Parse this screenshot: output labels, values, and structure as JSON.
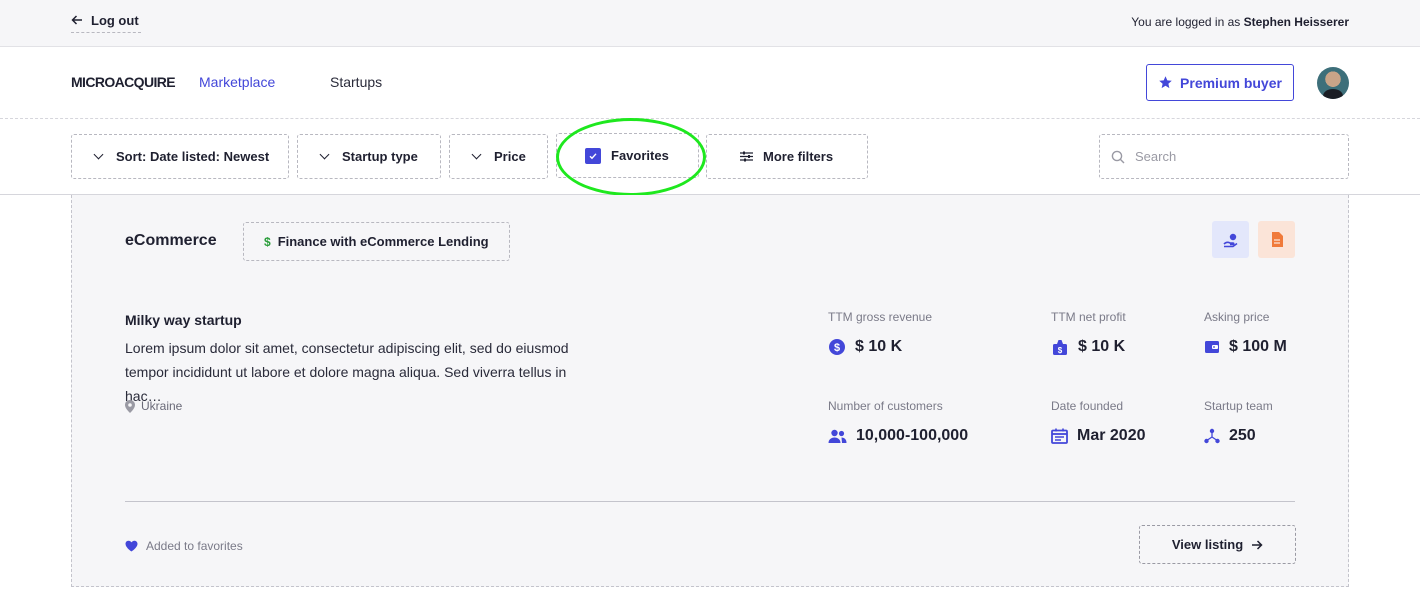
{
  "topbar": {
    "logout_label": "Log out",
    "logged_in_prefix": "You are logged in as",
    "user_name": "Stephen Heisserer"
  },
  "nav": {
    "logo_text": "MICROACQUIRE",
    "links": [
      {
        "label": "Marketplace",
        "active": true
      },
      {
        "label": "Startups",
        "active": false
      }
    ],
    "premium_label": "Premium buyer",
    "accent_color": "#4347d9"
  },
  "filters": {
    "sort_label": "Sort: Date listed: Newest",
    "startup_type_label": "Startup type",
    "price_label": "Price",
    "favorites_label": "Favorites",
    "favorites_checked": true,
    "more_filters_label": "More filters",
    "search_placeholder": "Search",
    "search_value": ""
  },
  "listing": {
    "category": "eCommerce",
    "tag": "Finance with eCommerce Lending",
    "name": "Milky way startup",
    "description": "Lorem ipsum dolor sit amet, consectetur adipiscing elit, sed do eiusmod tempor incididunt ut labore et dolore magna aliqua. Sed viverra tellus in hac…",
    "location": "Ukraine",
    "metrics": {
      "ttm_gross_revenue": {
        "label": "TTM gross revenue",
        "value": "$ 10 K"
      },
      "ttm_net_profit": {
        "label": "TTM net profit",
        "value": "$ 10 K"
      },
      "asking_price": {
        "label": "Asking price",
        "value": "$ 100 M"
      },
      "customers": {
        "label": "Number of customers",
        "value": "10,000-100,000"
      },
      "date_founded": {
        "label": "Date founded",
        "value": "Mar 2020"
      },
      "startup_team": {
        "label": "Startup team",
        "value": "250"
      }
    },
    "favorite_text": "Added to favorites",
    "view_label": "View listing"
  }
}
